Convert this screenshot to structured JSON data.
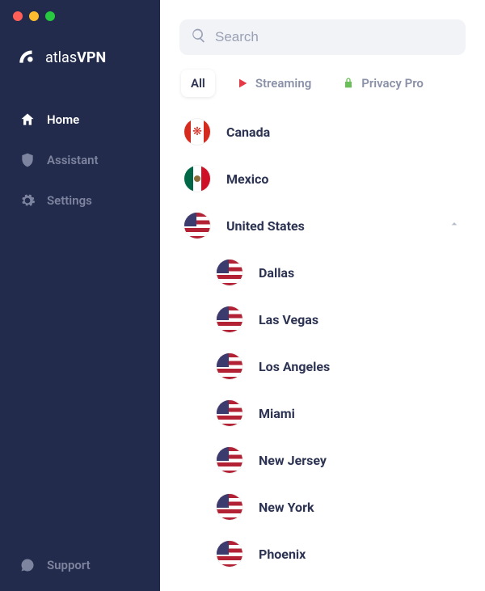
{
  "brand": {
    "name_prefix": "atlas",
    "name_suffix": "VPN"
  },
  "nav": {
    "home": "Home",
    "assistant": "Assistant",
    "settings": "Settings",
    "support": "Support"
  },
  "search": {
    "placeholder": "Search"
  },
  "tabs": {
    "all": "All",
    "streaming": "Streaming",
    "privacy": "Privacy Pro"
  },
  "servers": {
    "countries": [
      {
        "name": "Canada",
        "flag": "canada"
      },
      {
        "name": "Mexico",
        "flag": "mexico"
      },
      {
        "name": "United States",
        "flag": "us",
        "expanded": true,
        "cities": [
          "Dallas",
          "Las Vegas",
          "Los Angeles",
          "Miami",
          "New Jersey",
          "New York",
          "Phoenix"
        ]
      }
    ]
  }
}
